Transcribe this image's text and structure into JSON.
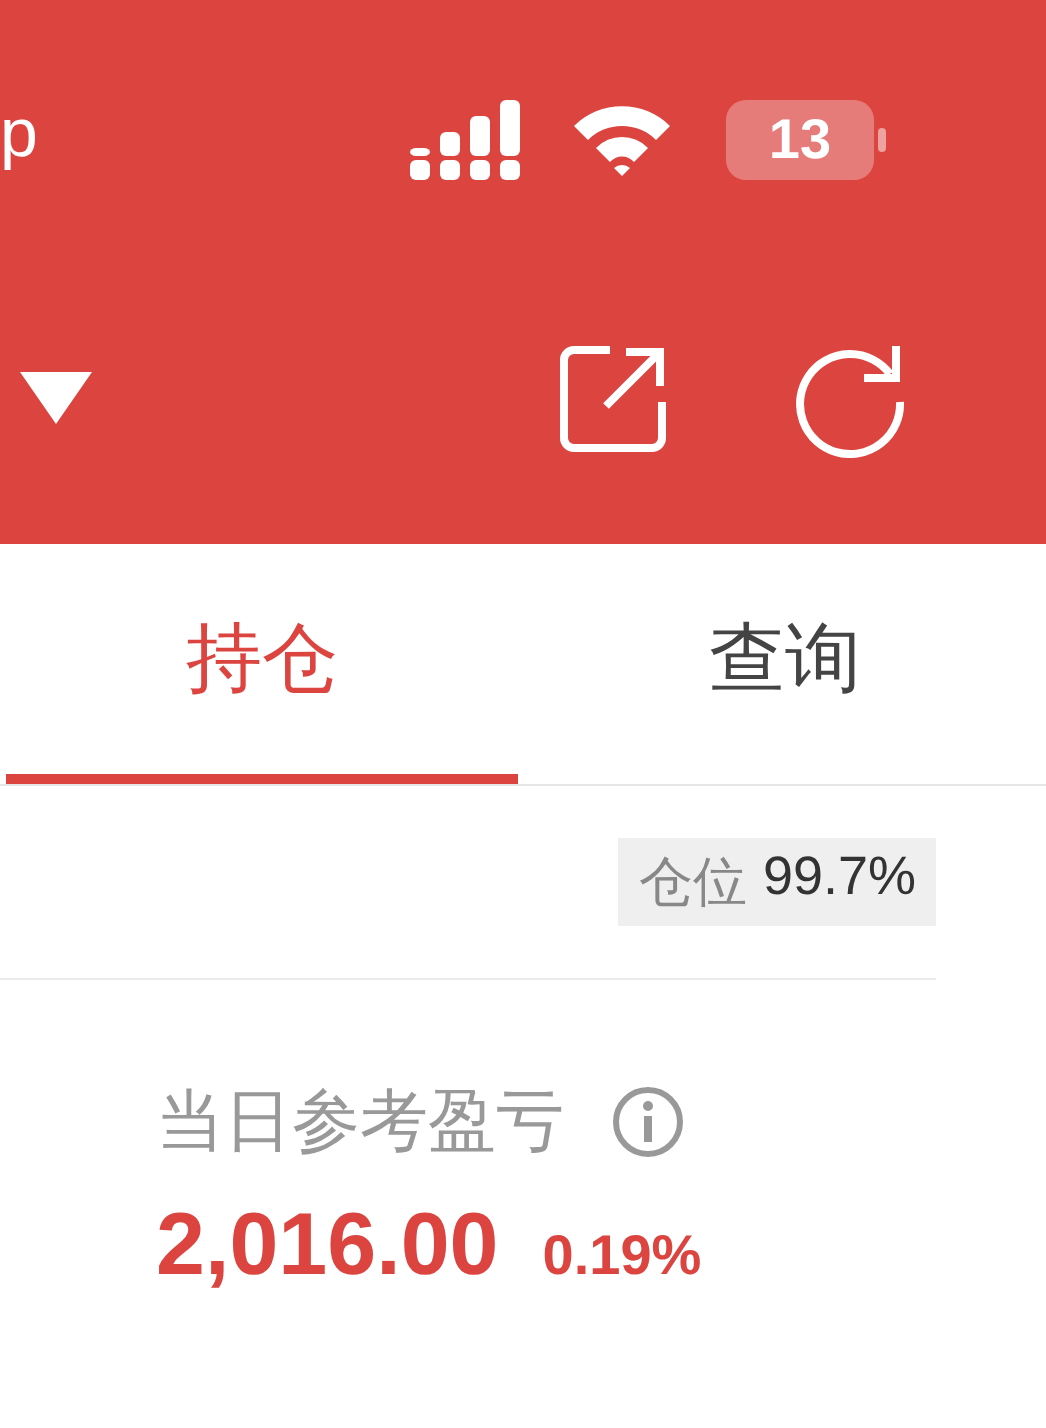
{
  "status_bar": {
    "carrier": "p",
    "battery": "13"
  },
  "tabs": [
    {
      "label": "持仓",
      "selected": true
    },
    {
      "label": "查询",
      "selected": false
    }
  ],
  "position_badge": {
    "label": "仓位",
    "value": "99.7%"
  },
  "pnl": {
    "label": "当日参考盈亏",
    "amount": "2,016.00",
    "percent": "0.19%"
  }
}
